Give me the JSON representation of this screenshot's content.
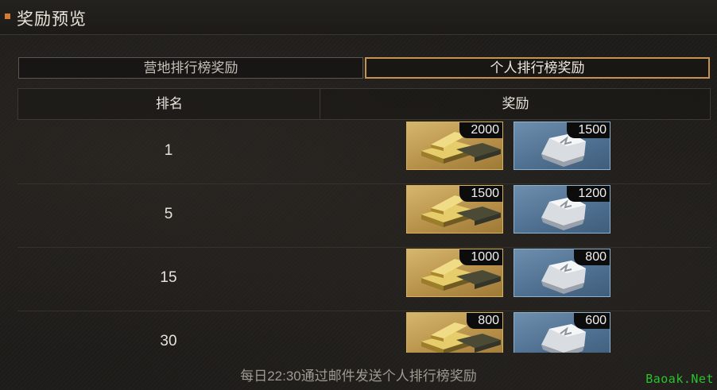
{
  "header": {
    "title": "奖励预览"
  },
  "tabs": [
    {
      "label": "营地排行榜奖励",
      "active": false
    },
    {
      "label": "个人排行榜奖励",
      "active": true
    }
  ],
  "table": {
    "headers": [
      "排名",
      "奖励"
    ],
    "rows": [
      {
        "rank": "1",
        "rewards": [
          {
            "icon": "gold-bars-icon",
            "count": "2000"
          },
          {
            "icon": "silver-ore-icon",
            "count": "1500"
          }
        ]
      },
      {
        "rank": "5",
        "rewards": [
          {
            "icon": "gold-bars-icon",
            "count": "1500"
          },
          {
            "icon": "silver-ore-icon",
            "count": "1200"
          }
        ]
      },
      {
        "rank": "15",
        "rewards": [
          {
            "icon": "gold-bars-icon",
            "count": "1000"
          },
          {
            "icon": "silver-ore-icon",
            "count": "800"
          }
        ]
      },
      {
        "rank": "30",
        "rewards": [
          {
            "icon": "gold-bars-icon",
            "count": "800"
          },
          {
            "icon": "silver-ore-icon",
            "count": "600"
          }
        ]
      }
    ]
  },
  "footer": {
    "note": "每日22:30通过邮件发送个人排行榜奖励"
  },
  "watermark": "Baoak.Net",
  "colors": {
    "accent": "#d77a33",
    "active_tab_border": "#c79152",
    "gold_frame": "#d6b25a",
    "silver_frame": "#8fb2cf",
    "watermark": "#29c32b"
  }
}
